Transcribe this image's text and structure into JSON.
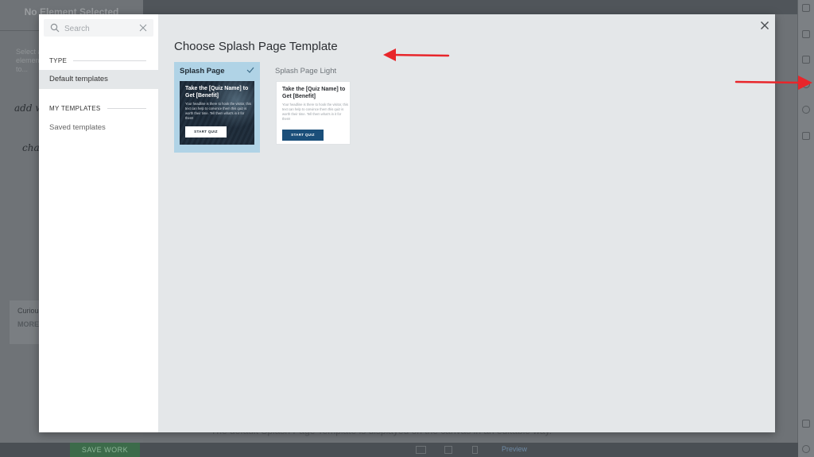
{
  "background": {
    "left_panel_title": "No Element Selected",
    "left_hint": "Select an element to...",
    "script_hint_1": "add w... eleme...",
    "script_hint_2": "cha... tem...",
    "promo_text": "Curious... cool fe...",
    "promo_more": "MORE",
    "save_label": "SAVE WORK",
    "preview_label": "Preview",
    "caption": "The default Splash Page Template is displayed on the canvas in an editable way."
  },
  "modal": {
    "title": "Choose Splash Page Template",
    "search": {
      "placeholder": "Search",
      "value": ""
    },
    "sections": [
      {
        "heading": "TYPE",
        "items": [
          {
            "label": "Default templates",
            "active": true
          }
        ]
      },
      {
        "heading": "MY TEMPLATES",
        "items": [
          {
            "label": "Saved templates",
            "active": false
          }
        ]
      }
    ],
    "templates": [
      {
        "name": "Splash Page",
        "selected": true,
        "headline": "Take the [Quiz Name] to Get [Benefit]",
        "body": "Your headline is there to hook the visitor, this text can help to convince them this quiz is worth their time. Tell them what's in it for them!",
        "button": "START QUIZ",
        "style": "dark"
      },
      {
        "name": "Splash Page Light",
        "selected": false,
        "headline": "Take the [Quiz Name] to Get [Benefit]",
        "body": "Your headline is there to hook the visitor, this text can help to convince them this quiz is worth their time. Tell them what's in it for them!",
        "button": "START QUIZ",
        "style": "light"
      }
    ]
  },
  "colors": {
    "accent_selected": "#b0d3e6",
    "button_blue": "#1b4f7a",
    "annotation_red": "#e8262b"
  },
  "icons": {
    "search": "search-icon",
    "clear": "clear-icon",
    "close": "close-icon",
    "check": "check-icon",
    "arrow": "red-arrow-annotation"
  }
}
